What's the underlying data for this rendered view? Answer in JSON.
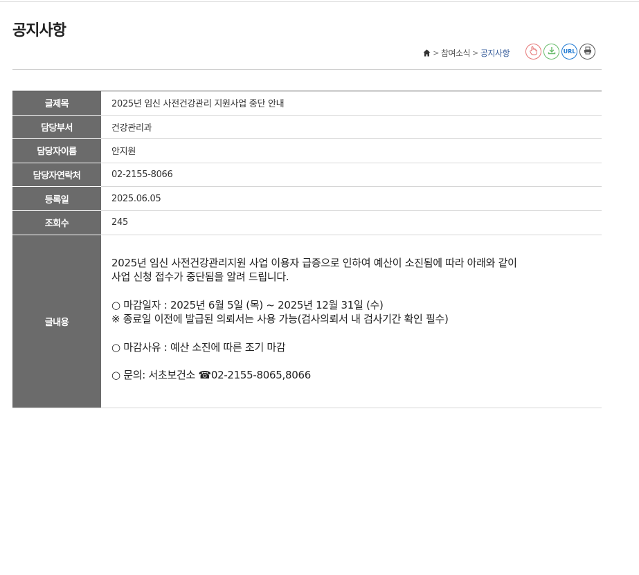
{
  "page": {
    "title": "공지사항"
  },
  "breadcrumb": {
    "items": [
      "참여소식",
      "공지사항"
    ]
  },
  "tools": {
    "url_label": "URL"
  },
  "fields": [
    {
      "label": "글제목",
      "value": "2025년 임신 사전건강관리 지원사업 중단 안내"
    },
    {
      "label": "담당부서",
      "value": "건강관리과"
    },
    {
      "label": "담당자이름",
      "value": "안지원"
    },
    {
      "label": "담당자연락처",
      "value": "02-2155-8066"
    },
    {
      "label": "등록일",
      "value": "2025.06.05"
    },
    {
      "label": "조회수",
      "value": "245"
    }
  ],
  "body": {
    "label": "글내용",
    "lines": [
      "2025년 임신 사전건강관리지원 사업 이용자 급증으로 인하여 예산이 소진됨에 따라 아래와 같이",
      "사업 신청 접수가 중단됨을 알려 드립니다.",
      "",
      "○ 마감일자 : 2025년 6월 5일 (목) ~ 2025년 12월 31일 (수)",
      "※ 종료일 이전에 발급된 의뢰서는 사용 가능(검사의뢰서 내 검사기간 확인 필수)",
      "",
      "○ 마감사유 : 예산 소진에 따른 조기 마감",
      "",
      "○ 문의: 서초보건소 ☎02-2155-8065,8066"
    ]
  }
}
